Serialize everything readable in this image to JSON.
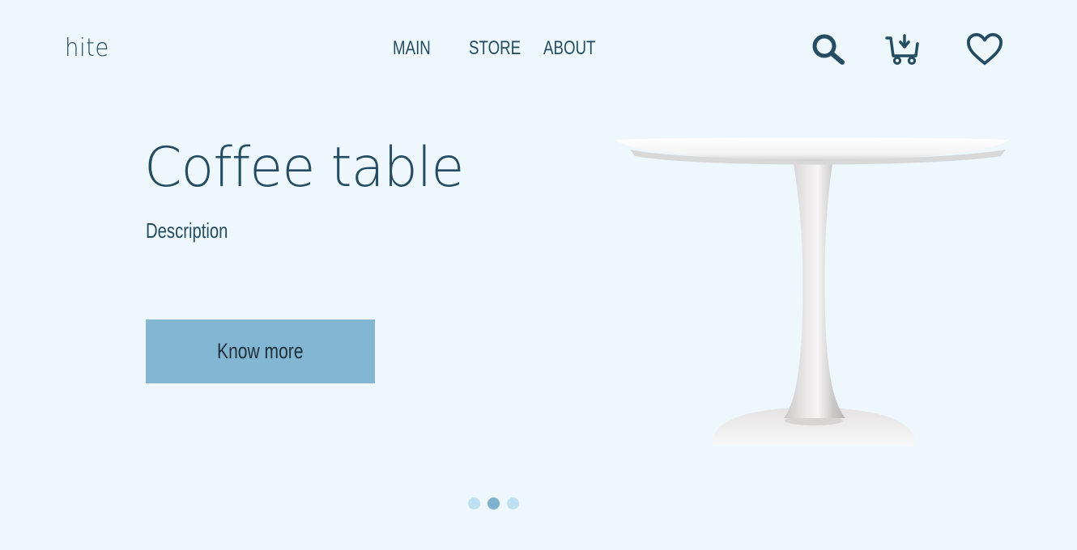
{
  "brand": {
    "logo_text": "hite"
  },
  "nav": {
    "items": [
      {
        "label": "MAIN"
      },
      {
        "label": "STORE"
      },
      {
        "label": "ABOUT"
      }
    ]
  },
  "header_icons": [
    "search-icon",
    "cart-icon",
    "heart-icon"
  ],
  "hero": {
    "title": "Coffee table",
    "description": "Description",
    "cta_label": "Know more",
    "image": "coffee-table-image"
  },
  "carousel": {
    "slides": 3,
    "active_index": 1
  },
  "colors": {
    "background": "#edf7fc",
    "text": "#244c63",
    "button": "#83b6d3",
    "dot": "#bfe0f2",
    "dot_active": "#7fb2cf"
  }
}
